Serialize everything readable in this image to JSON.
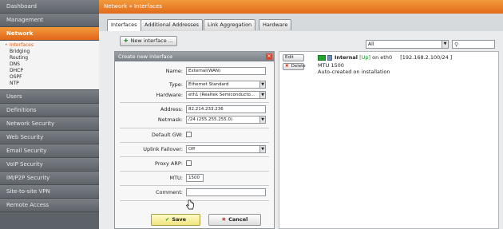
{
  "sidebar": {
    "items_top": [
      {
        "id": "dashboard",
        "label": "Dashboard"
      },
      {
        "id": "management",
        "label": "Management"
      },
      {
        "id": "network",
        "label": "Network",
        "active": true
      }
    ],
    "network_subitems": [
      {
        "label": "Interfaces",
        "active": true
      },
      {
        "label": "Bridging"
      },
      {
        "label": "Routing"
      },
      {
        "label": "DNS"
      },
      {
        "label": "DHCP"
      },
      {
        "label": "OSPF"
      },
      {
        "label": "NTP"
      }
    ],
    "items_bottom": [
      {
        "label": "Users"
      },
      {
        "label": "Definitions"
      },
      {
        "label": "Network Security"
      },
      {
        "label": "Web Security"
      },
      {
        "label": "Email Security"
      },
      {
        "label": "VoIP Security"
      },
      {
        "label": "IM/P2P Security"
      },
      {
        "label": "Site-to-site VPN"
      },
      {
        "label": "Remote Access"
      }
    ]
  },
  "header": {
    "breadcrumb": "Network » Interfaces"
  },
  "tabs": [
    {
      "label": "Interfaces",
      "active": true
    },
    {
      "label": "Additional Addresses"
    },
    {
      "label": "Link Aggregation"
    },
    {
      "label": "Hardware"
    }
  ],
  "toolbar": {
    "new_interface_label": "New interface ...",
    "filter_value": "All",
    "search_value": ""
  },
  "dialog": {
    "title": "Create new interface",
    "fields": {
      "name": {
        "label": "Name:",
        "value": "External(WAN)"
      },
      "type": {
        "label": "Type:",
        "value": "Ethernet Standard"
      },
      "hardware": {
        "label": "Hardware:",
        "value": "eth1 (Realtek Semiconducto..."
      },
      "address": {
        "label": "Address:",
        "value": "82.214.233.236"
      },
      "netmask": {
        "label": "Netmask:",
        "value": "/24 (255.255.255.0)"
      },
      "default_gw": {
        "label": "Default GW:",
        "checked": false
      },
      "uplink_failover": {
        "label": "Uplink Failover:",
        "value": "Off"
      },
      "proxy_arp": {
        "label": "Proxy ARP:",
        "checked": false
      },
      "mtu": {
        "label": "MTU:",
        "value": "1500"
      },
      "comment": {
        "label": "Comment:",
        "value": ""
      }
    },
    "save_label": "Save",
    "cancel_label": "Cancel"
  },
  "interfaces": [
    {
      "edit_label": "Edit",
      "delete_label": "Delete",
      "name": "Internal",
      "status": "[Up]",
      "device_text": "on eth0",
      "network": "[192.168.2.100/24 ]",
      "mtu_text": "MTU 1500",
      "comment": "Auto-created on installation"
    }
  ],
  "colors": {
    "accent": "#e0661a",
    "status_up": "#1fa52d",
    "sidebar": "#5d6268"
  }
}
